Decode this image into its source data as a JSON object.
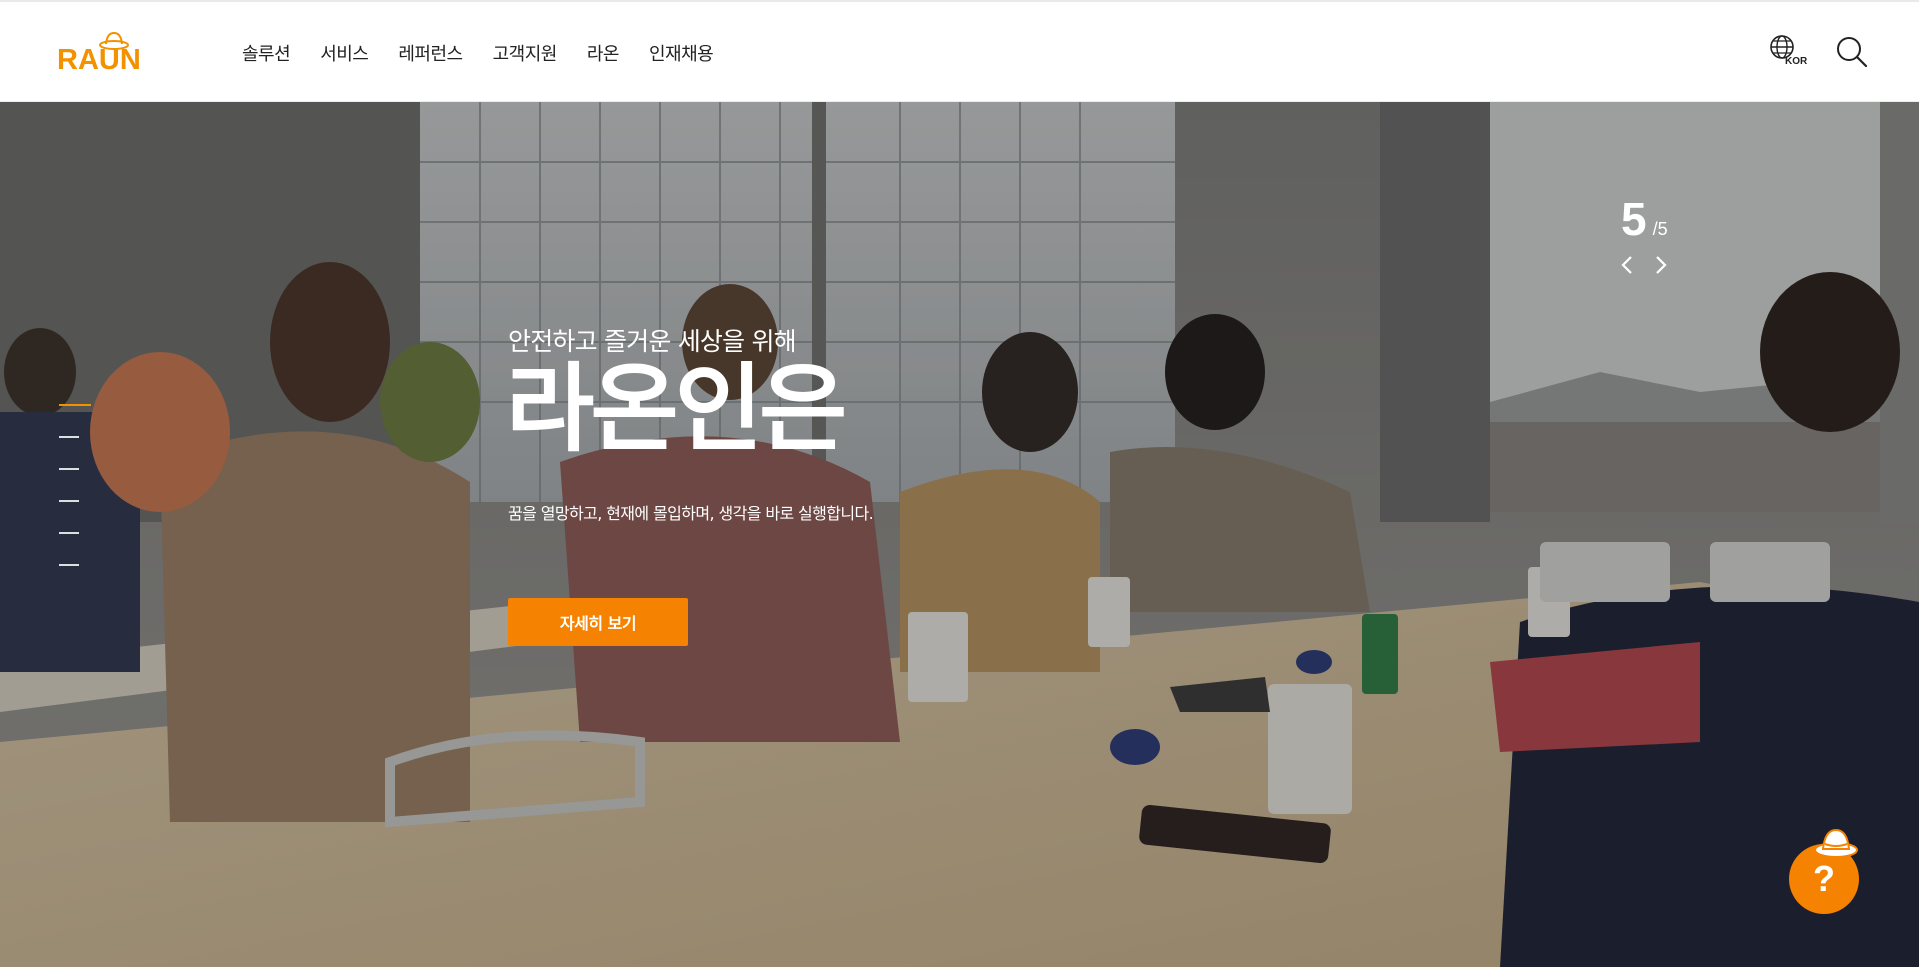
{
  "brand": {
    "logo_text": "RAUN",
    "accent": "#f39200",
    "cta_color": "#f58200"
  },
  "nav": {
    "items": [
      "솔루션",
      "서비스",
      "레퍼런스",
      "고객지원",
      "라온",
      "인재채용"
    ]
  },
  "header_tools": {
    "language": "KOR",
    "globe_icon": "globe-icon",
    "search_icon": "search-icon"
  },
  "hero": {
    "subtitle": "안전하고 즐거운 세상을 위해",
    "title": "라온인은",
    "description": "꿈을 열망하고, 현재에 몰입하며, 생각을 바로 실행합니다.",
    "cta_label": "자세히 보기",
    "slides_total": 6,
    "active_slide_index": 0
  },
  "slider": {
    "current": "5",
    "separator": "/",
    "total": "5",
    "prev_icon": "chevron-left-icon",
    "next_icon": "chevron-right-icon"
  },
  "help": {
    "label": "?",
    "icon": "hat-icon"
  }
}
